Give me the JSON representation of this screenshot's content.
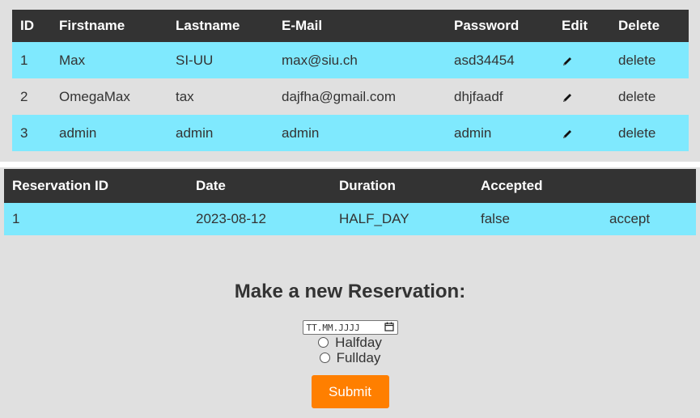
{
  "users_table": {
    "headers": [
      "ID",
      "Firstname",
      "Lastname",
      "E-Mail",
      "Password",
      "Edit",
      "Delete"
    ],
    "rows": [
      {
        "id": "1",
        "firstname": "Max",
        "lastname": "SI-UU",
        "email": "max@siu.ch",
        "password": "asd34454",
        "delete": "delete"
      },
      {
        "id": "2",
        "firstname": "OmegaMax",
        "lastname": "tax",
        "email": "dajfha@gmail.com",
        "password": "dhjfaadf",
        "delete": "delete"
      },
      {
        "id": "3",
        "firstname": "admin",
        "lastname": "admin",
        "email": "admin",
        "password": "admin",
        "delete": "delete"
      }
    ]
  },
  "reservations_table": {
    "headers": [
      "Reservation ID",
      "Date",
      "Duration",
      "Accepted",
      ""
    ],
    "rows": [
      {
        "id": "1",
        "date": "2023-08-12",
        "duration": "HALF_DAY",
        "accepted": "false",
        "action": "accept"
      }
    ]
  },
  "form": {
    "title": "Make a new Reservation:",
    "date_placeholder": "TT.MM.JJJJ",
    "options": [
      "Halfday",
      "Fullday"
    ],
    "submit_label": "Submit"
  },
  "colors": {
    "header_bg": "#333333",
    "row_highlight": "#7fe9fe",
    "panel_bg": "#e0e0e0",
    "submit_bg": "#ff7f00"
  },
  "icons": {
    "edit": "pencil-icon",
    "calendar": "calendar-icon"
  }
}
